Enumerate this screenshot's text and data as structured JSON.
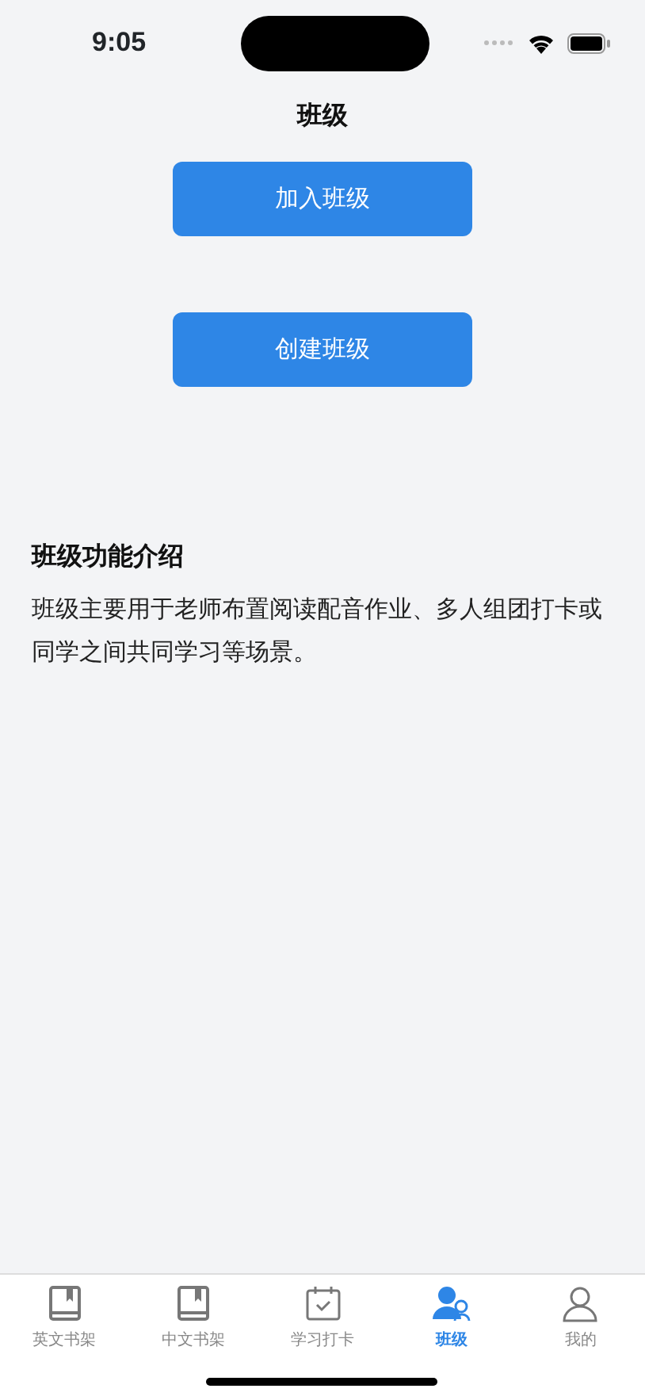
{
  "status_bar": {
    "time": "9:05"
  },
  "nav": {
    "title": "班级"
  },
  "buttons": [
    "加入班级",
    "创建班级"
  ],
  "intro": {
    "title": "班级功能介绍",
    "body": "班级主要用于老师布置阅读配音作业、多人组团打卡或同学之间共同学习等场景。"
  },
  "tabs": [
    {
      "label": "英文书架",
      "kind": "book",
      "selected": false
    },
    {
      "label": "中文书架",
      "kind": "book",
      "selected": false
    },
    {
      "label": "学习打卡",
      "kind": "calendar",
      "selected": false
    },
    {
      "label": "班级",
      "kind": "group",
      "selected": true
    },
    {
      "label": "我的",
      "kind": "person",
      "selected": false
    }
  ]
}
